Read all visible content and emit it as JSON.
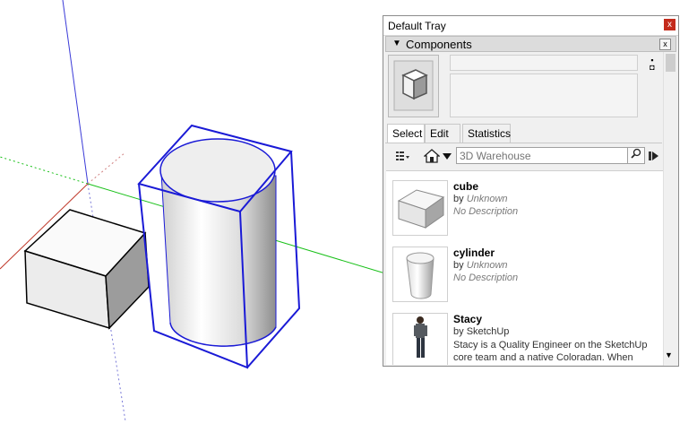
{
  "tray": {
    "title": "Default Tray",
    "close_glyph": "x",
    "components_header": {
      "label": "Components",
      "collapse_glyph": "▼",
      "close_glyph": "x"
    },
    "tabs": [
      "Select",
      "Edit",
      "Statistics"
    ],
    "search": {
      "placeholder": "3D Warehouse",
      "value": ""
    },
    "results": [
      {
        "title": "cube",
        "by_prefix": "by",
        "author": "Unknown",
        "description": "No Description"
      },
      {
        "title": "cylinder",
        "by_prefix": "by",
        "author": "Unknown",
        "description": "No Description"
      },
      {
        "title": "Stacy",
        "by_prefix": "by",
        "author": "SketchUp",
        "description": "Stacy is a Quality Engineer on the SketchUp core team and a native Coloradan. When she’s…"
      }
    ]
  },
  "icons": {
    "preview": "component-preview-icon",
    "detail": "details-arrow-icon",
    "view_options": "view-options-icon",
    "home": "home-icon",
    "dropdown": "dropdown-arrow-icon",
    "search": "search-icon",
    "navigate": "navigate-arrow-icon"
  },
  "colors": {
    "selection": "#1a1ad6",
    "axis_red": "#c0392b",
    "axis_green": "#19c019",
    "axis_blue": "#3b3bd8",
    "tray_close": "#c42b1c"
  }
}
